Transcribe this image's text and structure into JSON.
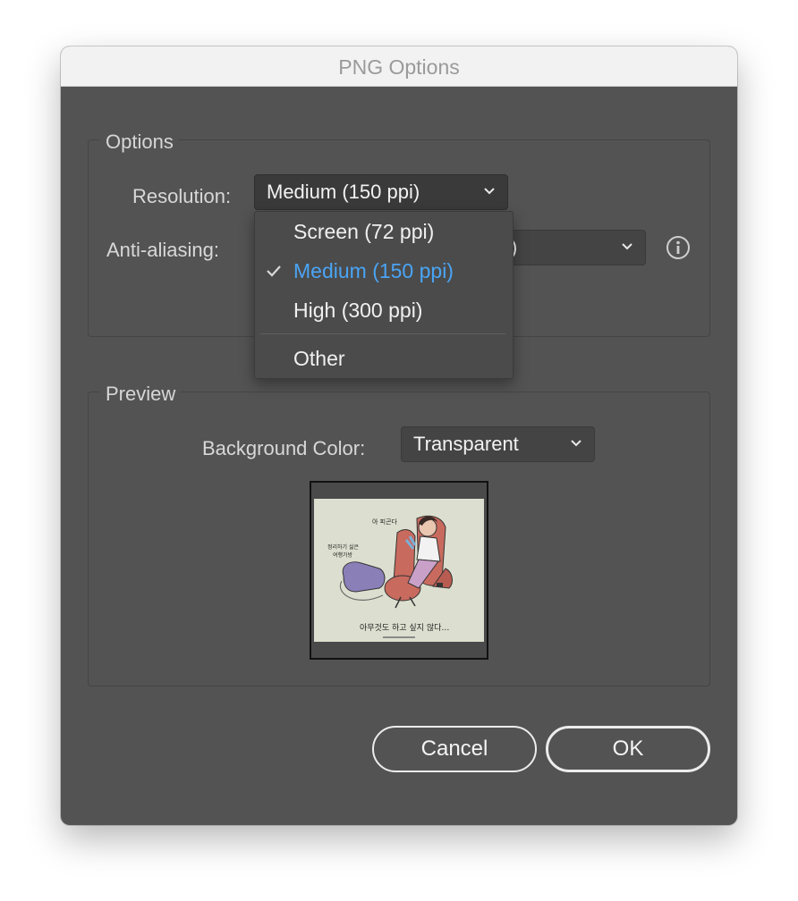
{
  "window": {
    "title": "PNG Options"
  },
  "options": {
    "legend": "Options",
    "resolution_label": "Resolution:",
    "resolution_value": "Medium (150 ppi)",
    "antialiasing_label": "Anti-aliasing:",
    "antialiasing_value_partial": ")"
  },
  "resolution_menu": {
    "items": [
      {
        "label": "Screen (72 ppi)",
        "selected": false
      },
      {
        "label": "Medium (150 ppi)",
        "selected": true
      },
      {
        "label": "High (300 ppi)",
        "selected": false
      },
      {
        "label": "Other",
        "selected": false
      }
    ]
  },
  "preview": {
    "legend": "Preview",
    "background_label": "Background Color:",
    "background_value": "Transparent",
    "image_text": {
      "line1": "아 피곤다",
      "line2": "정리하기 싫은",
      "line3": "여행가방",
      "caption": "아무것도 하고 싶지 않다…"
    }
  },
  "buttons": {
    "cancel": "Cancel",
    "ok": "OK"
  },
  "colors": {
    "dialog_bg": "#535353",
    "selected_item": "#4aa4f4",
    "illustration_bg": "#dcdfcf"
  }
}
